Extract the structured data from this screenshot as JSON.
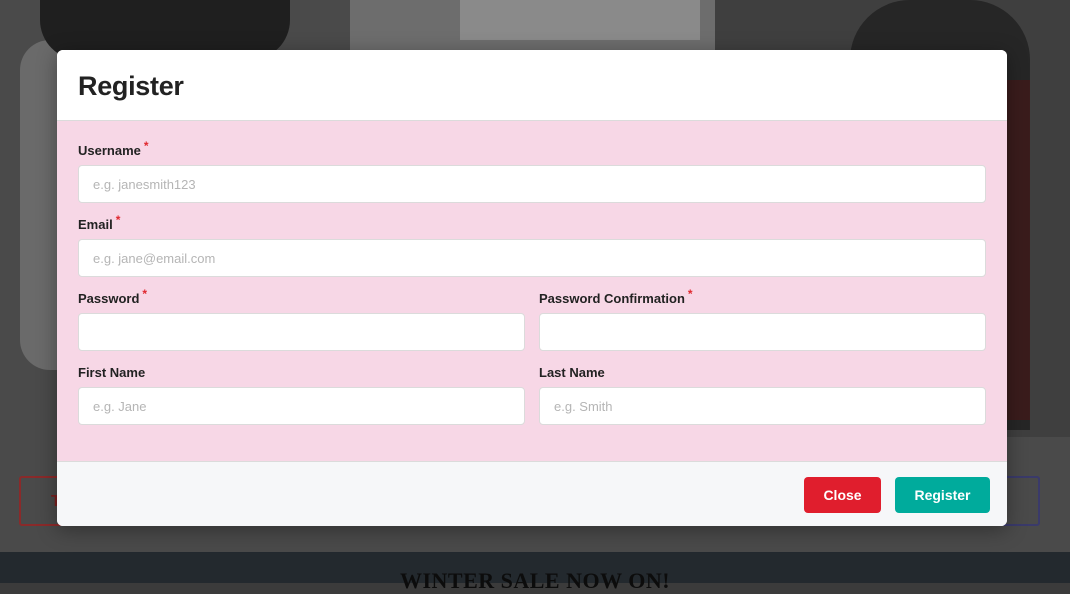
{
  "background": {
    "banner_text": "WINTER SALE NOW ON!",
    "left_button_letter": "T"
  },
  "modal": {
    "title": "Register",
    "fields": {
      "username": {
        "label": "Username",
        "required_mark": "*",
        "placeholder": "e.g. janesmith123",
        "value": ""
      },
      "email": {
        "label": "Email",
        "required_mark": "*",
        "placeholder": "e.g. jane@email.com",
        "value": ""
      },
      "password": {
        "label": "Password",
        "required_mark": "*",
        "placeholder": "",
        "value": ""
      },
      "password_confirmation": {
        "label": "Password Confirmation",
        "required_mark": "*",
        "placeholder": "",
        "value": ""
      },
      "first_name": {
        "label": "First Name",
        "placeholder": "e.g. Jane",
        "value": ""
      },
      "last_name": {
        "label": "Last Name",
        "placeholder": "e.g. Smith",
        "value": ""
      }
    },
    "buttons": {
      "close": "Close",
      "register": "Register"
    }
  },
  "colors": {
    "body_bg": "#f7d7e6",
    "close_button": "#e01e2d",
    "register_button": "#00ab9c",
    "required_mark": "#e0282f"
  }
}
